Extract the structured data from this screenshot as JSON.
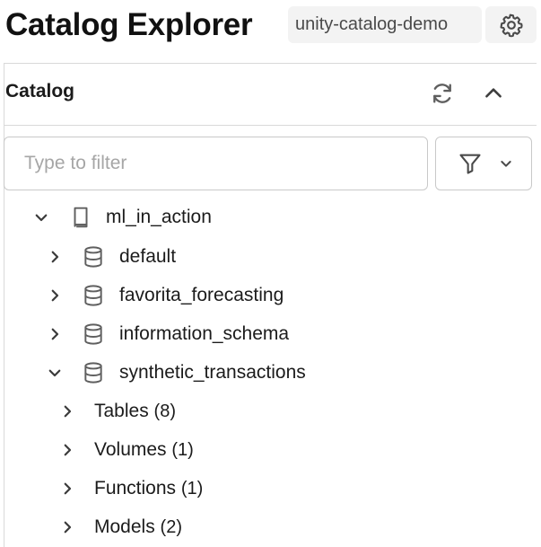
{
  "header": {
    "title": "Catalog Explorer",
    "workspace": "unity-catalog-demo",
    "settings_icon": "gear-icon"
  },
  "catalog_section": {
    "title": "Catalog",
    "refresh_icon": "refresh-icon",
    "collapse_icon": "chevron-up-icon"
  },
  "filter": {
    "placeholder": "Type to filter",
    "value": "",
    "filter_icon": "funnel-icon",
    "dropdown_icon": "chevron-down-icon"
  },
  "tree": {
    "catalog": {
      "label": "ml_in_action",
      "expanded": true,
      "icon": "book-icon"
    },
    "schemas": [
      {
        "label": "default",
        "expanded": false,
        "icon": "database-icon"
      },
      {
        "label": "favorita_forecasting",
        "expanded": false,
        "icon": "database-icon"
      },
      {
        "label": "information_schema",
        "expanded": false,
        "icon": "database-icon"
      },
      {
        "label": "synthetic_transactions",
        "expanded": true,
        "icon": "database-icon"
      }
    ],
    "groups": [
      {
        "label": "Tables",
        "count": "(8)"
      },
      {
        "label": "Volumes",
        "count": "(1)"
      },
      {
        "label": "Functions",
        "count": "(1)"
      },
      {
        "label": "Models",
        "count": "(2)"
      }
    ]
  },
  "colors": {
    "text": "#1b1b1b",
    "border": "#d9d9d9",
    "badge_bg": "#f3f3f3",
    "icon": "#5f5f5f"
  }
}
